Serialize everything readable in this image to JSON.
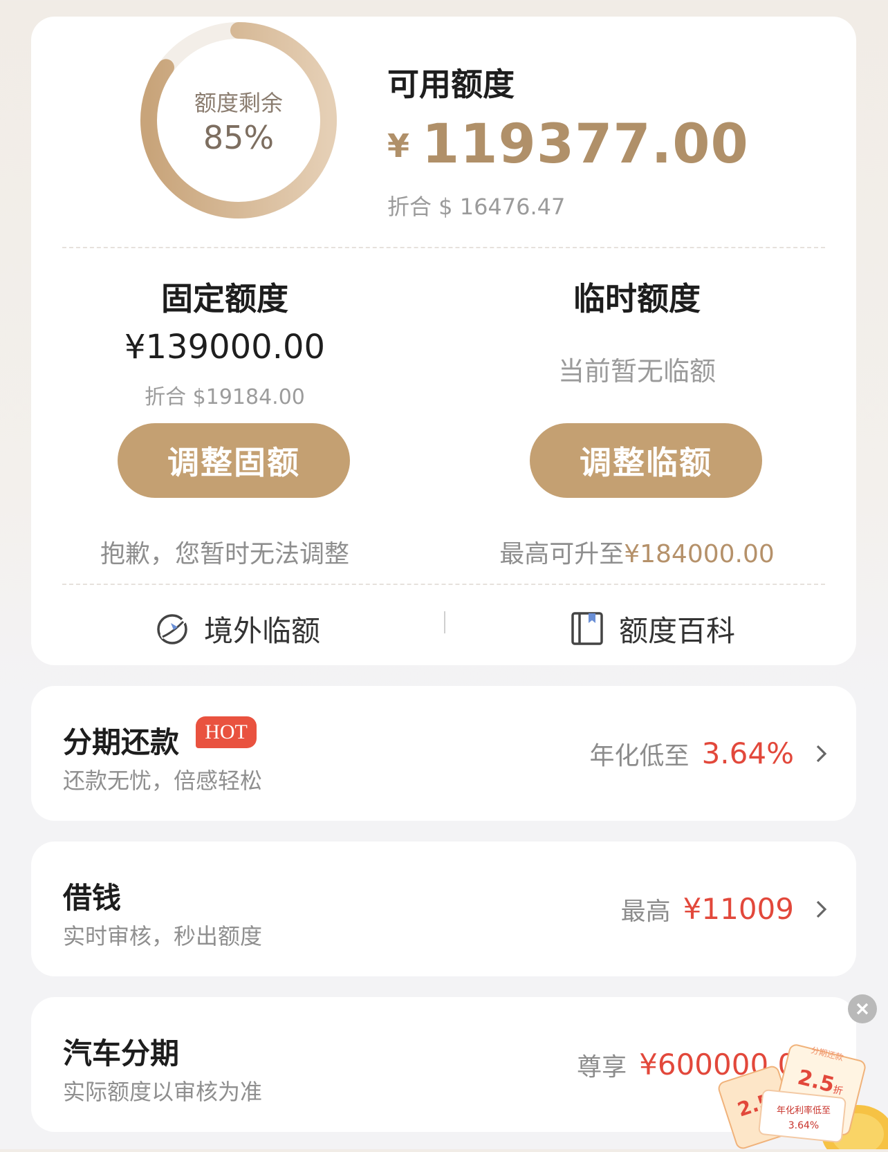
{
  "summary": {
    "ring_caption": "额度剩余",
    "ring_percent": "85%",
    "ring_fraction": 0.85,
    "available_title": "可用额度",
    "available_currency": "¥",
    "available_amount": "119377.00",
    "available_usd": "折合 $ 16476.47"
  },
  "fixed": {
    "title": "固定额度",
    "amount": "¥139000.00",
    "usd": "折合 $19184.00",
    "button": "调整固额",
    "note": "抱歉，您暂时无法调整"
  },
  "temporary": {
    "title": "临时额度",
    "status": "当前暂无临额",
    "button": "调整临额",
    "note_prefix": "最高可升至",
    "note_value": "¥184000.00"
  },
  "links": {
    "overseas": "境外临额",
    "wiki": "额度百科"
  },
  "services": [
    {
      "title": "分期还款",
      "badge": "HOT",
      "subtitle": "还款无忧，倍感轻松",
      "label": "年化低至",
      "value": "3.64%"
    },
    {
      "title": "借钱",
      "subtitle": "实时审核，秒出额度",
      "label": "最高",
      "value": "¥11009"
    },
    {
      "title": "汽车分期",
      "subtitle": "实际额度以审核为准",
      "label": "尊享",
      "value": "¥600000.00"
    }
  ],
  "promo": {
    "tag_top": "分期还款",
    "discount": "2.5",
    "discount_unit": "折",
    "rate_label": "年化利率低至",
    "rate_value": "3.64%"
  },
  "colors": {
    "gold": "#c4a072",
    "gold_text": "#b09069",
    "red": "#e2483b",
    "ring_track": "#f3eee8"
  }
}
